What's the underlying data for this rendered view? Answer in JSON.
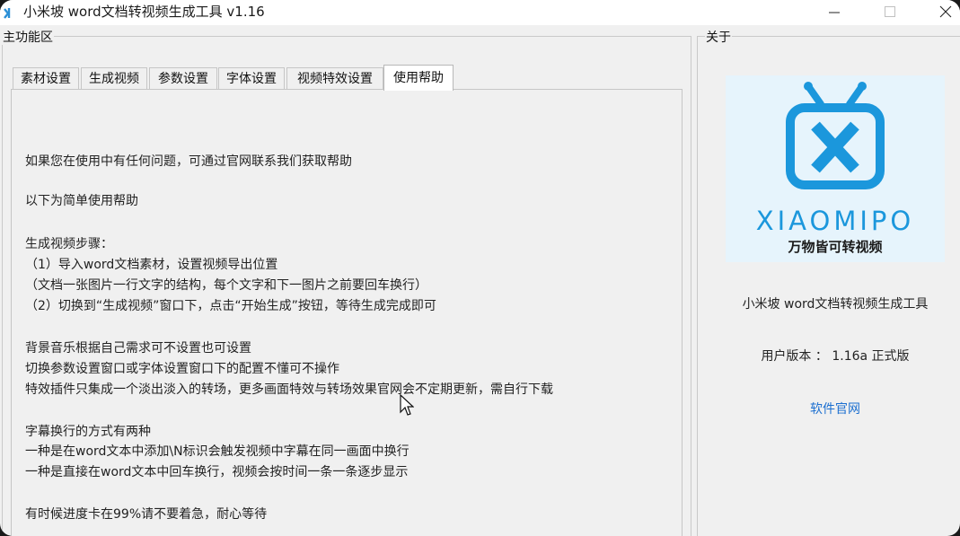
{
  "window": {
    "title": "小米坡 word文档转视频生成工具 v1.16"
  },
  "main_group": {
    "caption": "主功能区",
    "tabs": [
      {
        "label": "素材设置",
        "active": false
      },
      {
        "label": "生成视频",
        "active": false
      },
      {
        "label": "参数设置",
        "active": false
      },
      {
        "label": "字体设置",
        "active": false
      },
      {
        "label": "视频特效设置",
        "active": false
      },
      {
        "label": "使用帮助",
        "active": true
      }
    ],
    "help": {
      "lines": [
        "如果您在使用中有任何问题，可通过官网联系我们获取帮助",
        "以下为简单使用帮助",
        "生成视频步骤：",
        "（1）导入word文档素材，设置视频导出位置",
        "（文档一张图片一行文字的结构，每个文字和下一图片之前要回车换行）",
        "（2）切换到“生成视频”窗口下，点击“开始生成”按钮，等待生成完成即可",
        "背景音乐根据自己需求可不设置也可设置",
        "切换参数设置窗口或字体设置窗口下的配置不懂可不操作",
        "特效插件只集成一个淡出淡入的转场，更多画面特效与转场效果官网会不定期更新，需自行下载",
        "字幕换行的方式有两种",
        "一种是在word文本中添加\\N标识会触发视频中字幕在同一画面中换行",
        "一种是直接在word文本中回车换行，视频会按时间一条一条逐步显示",
        "有时候进度卡在99%请不要着急，耐心等待"
      ]
    }
  },
  "about_group": {
    "caption": "关于",
    "logo": {
      "brand": "XIAOMIPO",
      "slogan": "万物皆可转视频",
      "icon": "tv-x-logo-icon",
      "color": "#1b97dc",
      "background": "#e6f4fc"
    },
    "product_name": "小米坡 word文档转视频生成工具",
    "version_text": "用户版本 ： 1.16a 正式版",
    "website_link": "软件官网"
  },
  "colors": {
    "window_bg": "#f0f0f0",
    "link": "#1c6fd0",
    "accent": "#1b97dc"
  }
}
